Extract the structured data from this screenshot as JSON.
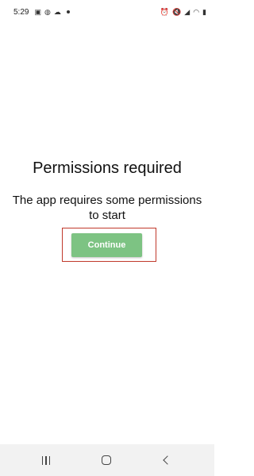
{
  "status_bar": {
    "time": "5:29",
    "left_icons": [
      "image-icon",
      "game-icon",
      "cloud-icon",
      "dot-icon"
    ],
    "right_icons": [
      "alarm-icon",
      "mute-icon",
      "signal-icon",
      "wifi-icon",
      "battery-icon"
    ]
  },
  "main": {
    "title": "Permissions required",
    "message": "The app requires some permissions to start",
    "continue_label": "Continue"
  },
  "colors": {
    "button": "#7dc383",
    "highlight": "#c0392b"
  },
  "nav_bar": {
    "items": [
      "recents-icon",
      "home-icon",
      "back-icon"
    ]
  }
}
